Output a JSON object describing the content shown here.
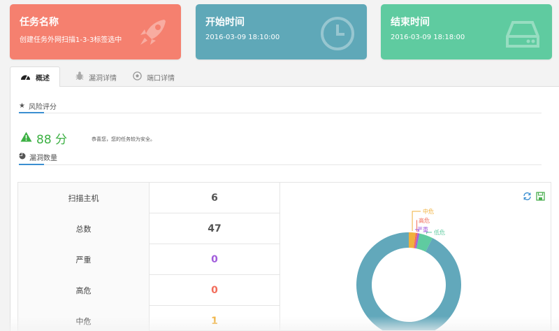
{
  "cards": {
    "task": {
      "title": "任务名称",
      "value": "创建任务外网扫描1-3-3标签选中",
      "icon": "rocket-icon",
      "color": "#f5806f"
    },
    "start": {
      "title": "开始时间",
      "value": "2016-03-09 18:10:00",
      "icon": "clock-icon",
      "color": "#5fa8b8"
    },
    "end": {
      "title": "结束时间",
      "value": "2016-03-09 18:18:00",
      "icon": "hard-drive-icon",
      "color": "#5fcba0"
    }
  },
  "tabs": [
    {
      "label": "概述",
      "icon": "dashboard-icon",
      "active": true
    },
    {
      "label": "漏洞详情",
      "icon": "bug-icon",
      "active": false
    },
    {
      "label": "端口详情",
      "icon": "football-icon",
      "active": false
    }
  ],
  "risk": {
    "section_title": "风险评分",
    "score": "88 分",
    "message": "恭喜您，您的任务较为安全。"
  },
  "vuln": {
    "section_title": "漏洞数量",
    "rows": [
      {
        "label": "扫描主机",
        "value": "6",
        "color": "#555555"
      },
      {
        "label": "总数",
        "value": "47",
        "color": "#555555"
      },
      {
        "label": "严重",
        "value": "0",
        "color": "#a25ddc"
      },
      {
        "label": "高危",
        "value": "0",
        "color": "#f26d5b"
      },
      {
        "label": "中危",
        "value": "1",
        "color": "#f0b13d"
      }
    ]
  },
  "chart_data": {
    "type": "pie",
    "series": [
      {
        "name": "中危",
        "value": 1,
        "color": "#f0b13d"
      },
      {
        "name": "高危",
        "value": 0,
        "color": "#f26d5b"
      },
      {
        "name": "严重",
        "value": 0,
        "color": "#a25ddc"
      },
      {
        "name": "低危",
        "value": 2,
        "color": "#5fcba0"
      },
      {
        "name": "",
        "value": 44,
        "color": "#62a8bb"
      }
    ]
  },
  "colors": {
    "accent": "#3b8fd1",
    "score_green": "#3cb043"
  }
}
